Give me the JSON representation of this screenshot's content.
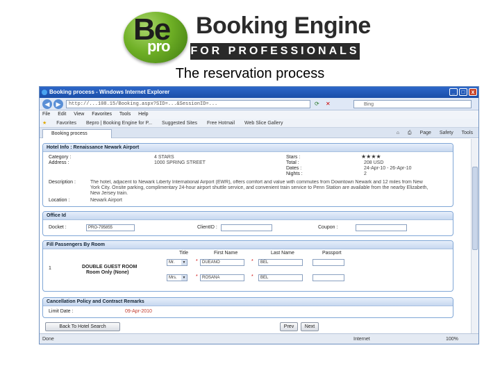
{
  "logo": {
    "be": "Be",
    "pro": "pro",
    "title": "Booking Engine",
    "subtitle": "FOR PROFESSIONALS"
  },
  "caption": "The reservation process",
  "browser": {
    "title": "Booking process - Windows Internet Explorer",
    "url": "http://...108.15/Booking.aspx?SID=...&SessionID=...",
    "search_placeholder": "Bing",
    "menu": [
      "File",
      "Edit",
      "View",
      "Favorites",
      "Tools",
      "Help"
    ],
    "favorites_label": "Favorites",
    "favorites": [
      "Bepro | Booking Engine for P...",
      "Suggested Sites",
      "Free Hotmail",
      "Web Slice Gallery"
    ],
    "tab_label": "Booking process",
    "commands": [
      "Page",
      "Safety",
      "Tools"
    ],
    "status_left": "Done",
    "status_zone": "Internet",
    "status_zoom": "100%"
  },
  "hotel_info": {
    "header": "Hotel Info : Renaissance Newark Airport",
    "category_label": "Category :",
    "category_value": "4 STARS",
    "address_label": "Address :",
    "address_value": "1000 SPRING STREET",
    "stars_label": "Stars :",
    "stars_value": "★★★★",
    "total_label": "Total :",
    "total_value": "208 USD",
    "dates_label": "Dates :",
    "dates_value": "24-Apr-10 - 26-Apr-10",
    "nights_label": "Nights :",
    "nights_value": "2",
    "description_label": "Description :",
    "description_value": "The hotel, adjacent to Newark Liberty International Airport (EWR), offers comfort and value with commutes from Downtown Newark and 12 miles from New York City. Onsite parking, complimentary 24-hour airport shuttle service, and convenient train service to Penn Station are available from the nearby Elizabeth, New Jersey train.",
    "location_label": "Location :",
    "location_value": "Newark Airport"
  },
  "office": {
    "header": "Office Id",
    "docket_label": "Docket :",
    "docket_value": "PRO-795855",
    "client_label": "ClientID :",
    "client_value": "",
    "coupon_label": "Coupon :",
    "coupon_value": ""
  },
  "passengers": {
    "header": "Fill Passengers By Room",
    "col_title": "Title",
    "col_first": "First Name",
    "col_last": "Last Name",
    "col_passport": "Passport",
    "room_index": "1",
    "room_type": "DOUBLE GUEST ROOM",
    "room_board": "Room Only (None)",
    "rows": [
      {
        "title": "Mr.",
        "first": "DUEANO",
        "last": "BEL",
        "passport": ""
      },
      {
        "title": "Mrs.",
        "first": "ROSANA",
        "last": "BEL",
        "passport": ""
      }
    ]
  },
  "cancellation": {
    "header": "Cancellation Policy and Contract Remarks",
    "limit_label": "Limit Date :",
    "limit_value": "09-Apr-2010"
  },
  "buttons": {
    "back": "Back To Hotel Search",
    "prev": "Prev",
    "next": "Next"
  }
}
